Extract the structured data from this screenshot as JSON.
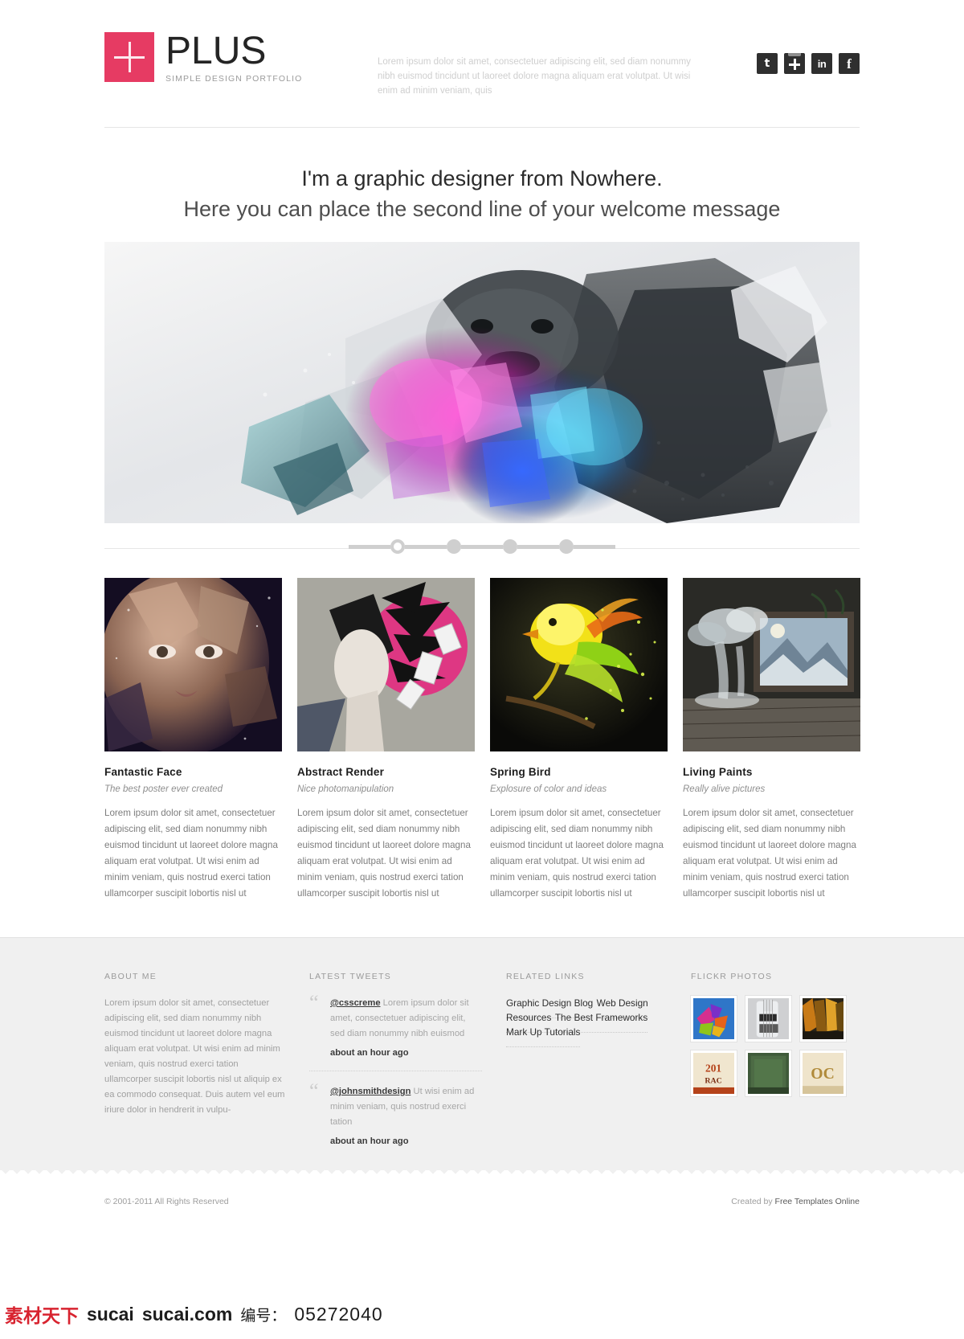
{
  "header": {
    "logo_icon": "plus-icon",
    "brand_title": "PLUS",
    "brand_subtitle": "SIMPLE DESIGN PORTFOLIO",
    "brand_color": "#e63b63",
    "tagline": "Lorem ipsum dolor sit amet, consectetuer adipiscing elit, sed diam nonummy nibh euismod tincidunt ut laoreet dolore magna aliquam erat volutpat. Ut wisi enim ad minim veniam, quis",
    "socials": [
      {
        "name": "twitter-icon",
        "glyph": "t"
      },
      {
        "name": "google-plus-icon",
        "glyph": "+"
      },
      {
        "name": "linkedin-icon",
        "glyph": "in"
      },
      {
        "name": "facebook-icon",
        "glyph": "f"
      }
    ]
  },
  "welcome": {
    "line1": "I'm a graphic designer from Nowhere.",
    "line2": "Here you can place the second line of your welcome message"
  },
  "slider": {
    "dot_count": 4,
    "active_index": 0
  },
  "portfolio": [
    {
      "title": "Fantastic Face",
      "subtitle": "The best poster ever created",
      "body": "Lorem ipsum dolor sit amet, consectetuer adipiscing elit, sed diam nonummy nibh euismod tincidunt ut laoreet dolore magna aliquam erat volutpat. Ut wisi enim ad minim veniam, quis nostrud exerci tation ullamcorper suscipit lobortis nisl ut"
    },
    {
      "title": "Abstract Render",
      "subtitle": "Nice photomanipulation",
      "body": "Lorem ipsum dolor sit amet, consectetuer adipiscing elit, sed diam nonummy nibh euismod tincidunt ut laoreet dolore magna aliquam erat volutpat. Ut wisi enim ad minim veniam, quis nostrud exerci tation ullamcorper suscipit lobortis nisl ut"
    },
    {
      "title": "Spring Bird",
      "subtitle": "Explosure of color and ideas",
      "body": "Lorem ipsum dolor sit amet, consectetuer adipiscing elit, sed diam nonummy nibh euismod tincidunt ut laoreet dolore magna aliquam erat volutpat. Ut wisi enim ad minim veniam, quis nostrud exerci tation ullamcorper suscipit lobortis nisl ut"
    },
    {
      "title": "Living Paints",
      "subtitle": "Really alive pictures",
      "body": "Lorem ipsum dolor sit amet, consectetuer adipiscing elit, sed diam nonummy nibh euismod tincidunt ut laoreet dolore magna aliquam erat volutpat. Ut wisi enim ad minim veniam, quis nostrud exerci tation ullamcorper suscipit lobortis nisl ut"
    }
  ],
  "footer": {
    "about": {
      "title": "ABOUT ME",
      "body": "Lorem ipsum dolor sit amet, consectetuer adipiscing elit, sed diam nonummy nibh euismod tincidunt ut laoreet dolore magna aliquam erat volutpat. Ut wisi enim ad minim veniam, quis nostrud exerci tation ullamcorper suscipit lobortis nisl ut aliquip ex ea commodo consequat. Duis autem vel eum iriure dolor in hendrerit in vulpu-"
    },
    "tweets": {
      "title": "LATEST TWEETS",
      "items": [
        {
          "user": "@csscreme",
          "text": " Lorem ipsum dolor sit amet, consectetuer adipiscing elit, sed diam nonummy nibh euismod",
          "time": "about an hour ago"
        },
        {
          "user": "@johnsmithdesign",
          "text": " Ut wisi enim ad minim veniam, quis nostrud exerci tation",
          "time": "about an hour ago"
        }
      ]
    },
    "links": {
      "title": "RELATED LINKS",
      "items": [
        "Graphic Design Blog",
        "Web Design Resources",
        "The Best  Frameworks",
        "Mark Up Tutorials"
      ]
    },
    "flickr": {
      "title": "FLICKR PHOTOS",
      "photo_count": 6
    }
  },
  "bottom_bar": {
    "copyright": "© 2001-2011 All Rights Reserved",
    "created_by": "Created by ",
    "template_link": "Free Templates Online"
  },
  "watermark": {
    "site_cn": "素材天下",
    "site_en": "sucai",
    "site_domain": "sucai.com",
    "label": "编号：",
    "number": "05272040"
  }
}
